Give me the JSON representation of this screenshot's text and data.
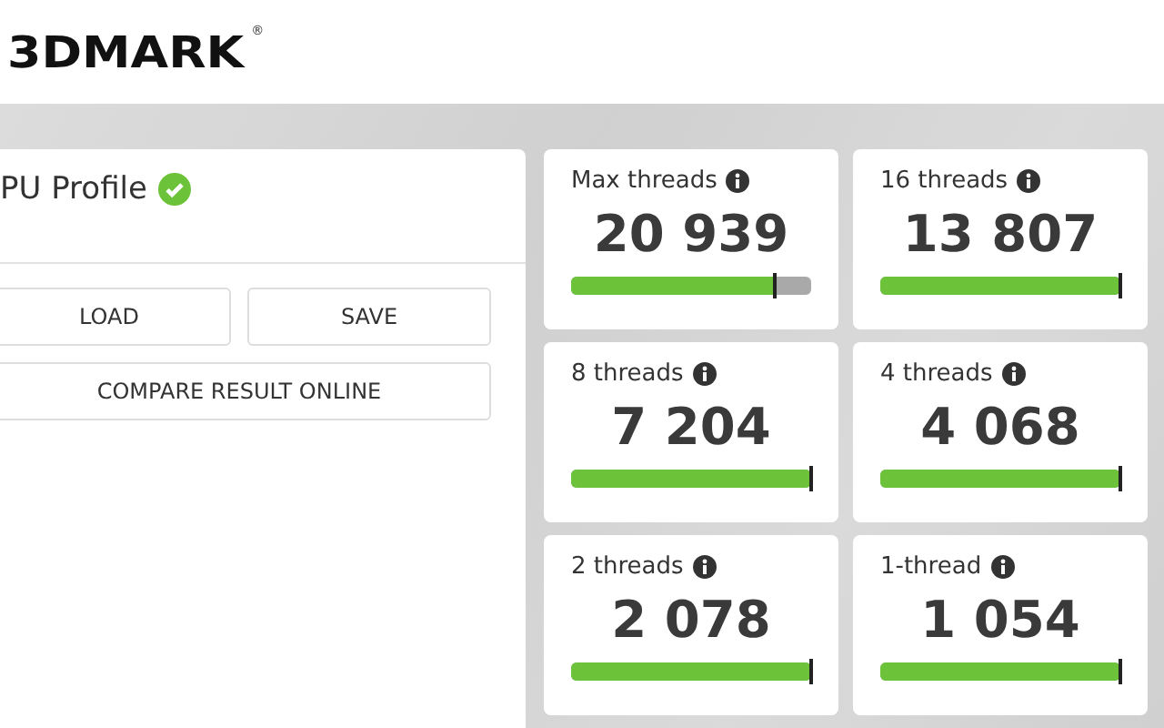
{
  "header": {
    "logo": "3DMARK",
    "registered_mark": "®"
  },
  "profile_card": {
    "title": "PU Profile",
    "verified": true,
    "buttons": [
      {
        "label": "LOAD"
      },
      {
        "label": "SAVE"
      },
      {
        "label": "COMPARE RESULT ONLINE"
      }
    ]
  },
  "scores": [
    {
      "label": "Max threads",
      "score": "20 939",
      "level": 0.85
    },
    {
      "label": "16 threads",
      "score": "13 807",
      "level": 1
    },
    {
      "label": "8 threads",
      "score": "7 204",
      "level": 1
    },
    {
      "label": "4 threads",
      "score": "4 068",
      "level": 1
    },
    {
      "label": "2 threads",
      "score": "2 078",
      "level": 1
    },
    {
      "label": "1-thread",
      "score": "1 054",
      "level": 1
    }
  ]
}
